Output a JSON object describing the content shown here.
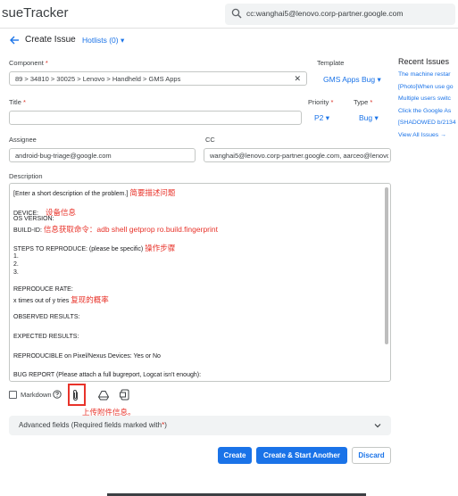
{
  "app": {
    "title": "sueTracker"
  },
  "search": {
    "query": "cc:wanghai5@lenovo.corp-partner.google.com"
  },
  "header": {
    "title": "Create Issue",
    "hotlists": "Hotlists (0) ▾"
  },
  "form": {
    "component_label": "Component",
    "component_value": "89 > 34810 > 30025 > Lenovo > Handheld > GMS Apps",
    "clear_glyph": "✕",
    "template_label": "Template",
    "template_value": "GMS Apps Bug ▾",
    "title_label": "Title",
    "title_value": "",
    "priority_label": "Priority",
    "priority_value": "P2 ▾",
    "type_label": "Type",
    "type_value": "Bug ▾",
    "required_mark": "*",
    "assignee_label": "Assignee",
    "assignee_value": "android-bug-triage@google.com",
    "cc_label": "CC",
    "cc_value": "wanghai5@lenovo.corp-partner.google.com, aarceo@lenovo",
    "description_label": "Description"
  },
  "description": {
    "l1": "[Enter a short description of the problem.]",
    "a1": "简要描述问题",
    "l2": "DEVICE:",
    "a2": "设备信息",
    "l3": "OS VERSION:",
    "l4": "BUILD-ID:",
    "a4": "信息获取命令：adb shell getprop ro.build.fingerprint",
    "l5": "STEPS TO REPRODUCE: (please be specific)",
    "a5": "操作步骤",
    "l6": "1.",
    "l7": "2.",
    "l8": "3.",
    "l9": "REPRODUCE RATE:",
    "l10": "x times out of y tries",
    "a10": "复现的概率",
    "l11": "OBSERVED RESULTS:",
    "l12": "EXPECTED RESULTS:",
    "l13": "REPRODUCIBLE on Pixel/Nexus Devices: Yes or No",
    "l14": "BUG REPORT (Please attach a full bugreport, Logcat isn't enough):"
  },
  "toolbar": {
    "markdown_label": "Markdown",
    "upload_note": "上传附件信息。"
  },
  "advanced": {
    "label": "Advanced fields (Required fields marked with",
    "mark": "*",
    "close": ")"
  },
  "buttons": {
    "create": "Create",
    "create_another": "Create & Start Another",
    "discard": "Discard"
  },
  "recent": {
    "title": "Recent Issues",
    "items": [
      "The machine restar",
      "[Photo]When use go",
      "Multiple users switc",
      "Click the Google As",
      "[SHADOWED b/2134",
      "View All Issues →"
    ]
  },
  "colors": {
    "accent": "#1a73e8",
    "annotation": "#e8332a",
    "required": "#d93025"
  }
}
